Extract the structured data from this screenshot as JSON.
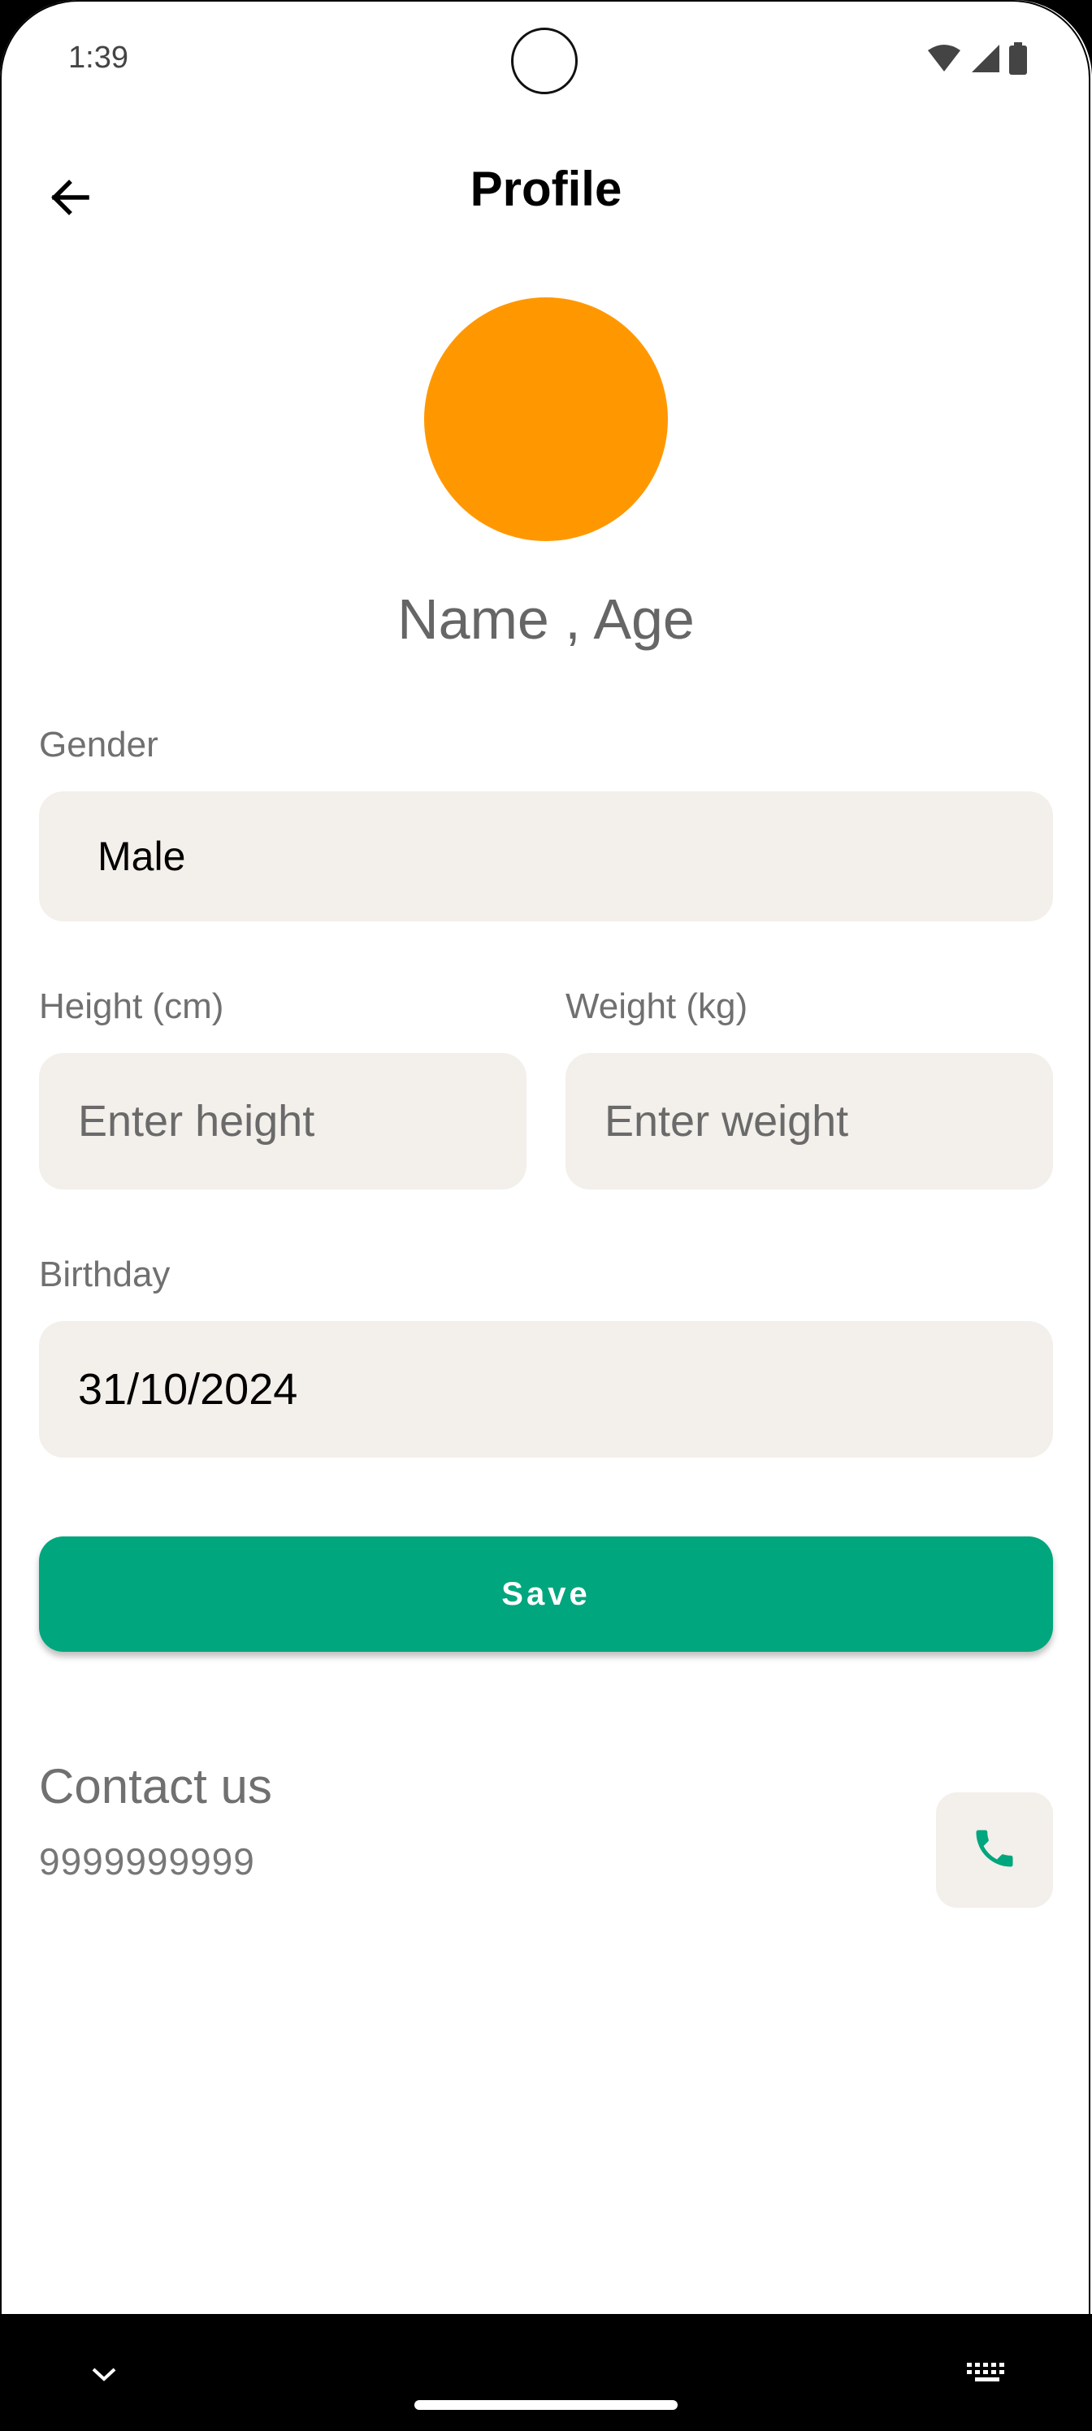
{
  "status_bar": {
    "time": "1:39",
    "icons": [
      "wifi-icon",
      "signal-icon",
      "battery-icon"
    ]
  },
  "app_bar": {
    "title": "Profile",
    "back_icon": "arrow-back-icon"
  },
  "profile": {
    "avatar_color": "#ff9800",
    "name_age": "Name , Age"
  },
  "form": {
    "gender": {
      "label": "Gender",
      "value": "Male"
    },
    "height": {
      "label": "Height (cm)",
      "value": "",
      "placeholder": "Enter height"
    },
    "weight": {
      "label": "Weight (kg)",
      "value": "",
      "placeholder": "Enter weight"
    },
    "birthday": {
      "label": "Birthday",
      "value": "31/10/2024"
    },
    "save_label": "Save"
  },
  "contact": {
    "title": "Contact us",
    "phone": "9999999999",
    "call_icon": "phone-icon"
  },
  "colors": {
    "accent": "#00a67d",
    "field_background": "#f3efea",
    "avatar": "#ff9800"
  },
  "nav_bar": {
    "icons": [
      "chevron-down-icon",
      "keyboard-icon"
    ]
  }
}
